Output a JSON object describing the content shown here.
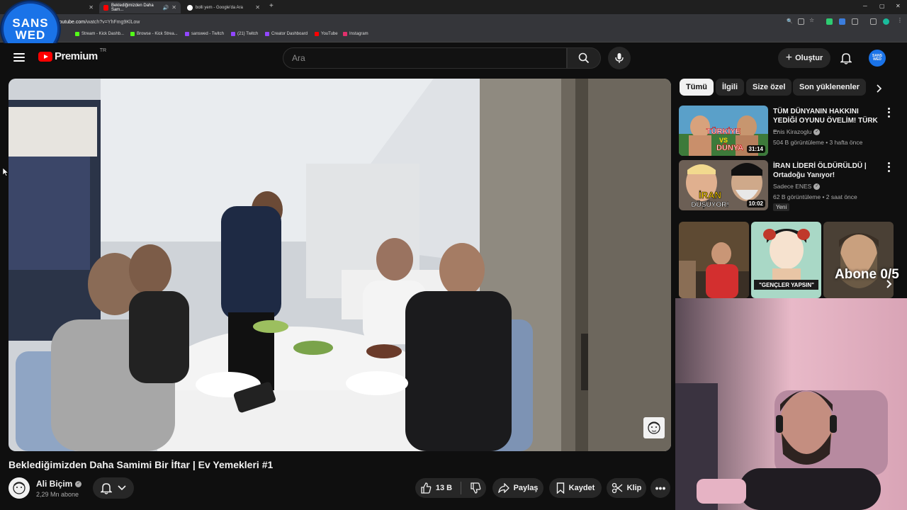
{
  "browser": {
    "tabs": [
      {
        "label": "",
        "active": false
      },
      {
        "label": "Beklediğimizden Daha Sam...",
        "active": true
      },
      {
        "label": "bolli yem - Google'da Ara",
        "active": false
      }
    ],
    "url_prefix": "",
    "url_domain": "youtube.com",
    "url_path": "/watch?v=YhFmg9KlLow",
    "bookmarks": [
      "Stream - Kick Dashb...",
      "Browse - Kick Strea...",
      "sanswed - Twitch",
      "(21) Twitch",
      "Creator Dashboard",
      "YouTube",
      "Instagram"
    ],
    "new_tab_symbol": "+"
  },
  "overlay": {
    "logo_line1": "SANS",
    "logo_line2": "WED"
  },
  "header": {
    "logo_text": "Premium",
    "country_code": "TR",
    "search_placeholder": "Ara",
    "create_label": "Oluştur",
    "avatar_line1": "SANS",
    "avatar_line2": "WED"
  },
  "video": {
    "title": "Beklediğimizden Daha Samimi Bir İftar | Ev Yemekleri #1",
    "channel_name": "Ali Biçim",
    "subscribers": "2,29 Mn abone",
    "like_count": "13 B",
    "share_label": "Paylaş",
    "save_label": "Kaydet",
    "clip_label": "Klip"
  },
  "chips": [
    "Tümü",
    "İlgili",
    "Size özel",
    "Son yüklenenler"
  ],
  "recommendations": [
    {
      "title": "TÜM DÜNYANIN HAKKINI YEDİĞİ OYUNU ÖVELİM! TÜRK ...",
      "channel": "Enis Kirazoglu",
      "meta": "504 B görüntüleme • 3 hafta önce",
      "duration": "31:14",
      "thumb_text1": "TÜRKİYE",
      "thumb_text2": "VS",
      "thumb_text3": "DÜNYA"
    },
    {
      "title": "İRAN LİDERİ ÖLDÜRÜLDÜ | Ortadoğu Yanıyor!",
      "channel": "Sadece ENES",
      "meta": "62 B görüntüleme • 2 saat önce",
      "badge": "Yeni",
      "duration": "10:02",
      "thumb_text1": "İRAN",
      "thumb_text2": "DÜŞÜYOR!"
    }
  ],
  "shorts": {
    "label": "Abone 0/5",
    "short2_caption": "\"GENÇLER YAPSIN\""
  },
  "colors": {
    "accent_red": "#ff0000",
    "brand_blue": "#1a73e8",
    "bg": "#0f0f0f",
    "chip": "#272727"
  }
}
